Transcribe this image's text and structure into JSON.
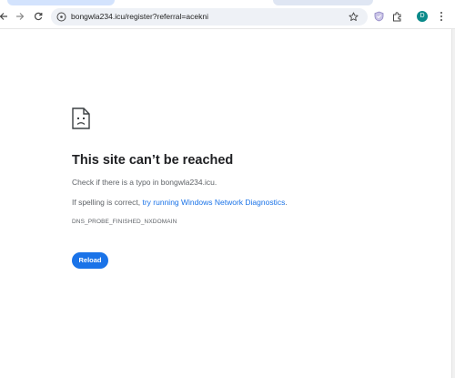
{
  "browser": {
    "url": "bongwla234.icu/register?referral=acekni",
    "profile_initial": "D",
    "colors": {
      "omnibox_bg": "#eef1f6",
      "accent": "#1a73e8",
      "profile": "#0b8a8a"
    }
  },
  "toolbar": {
    "back_icon": "arrow-left-icon",
    "forward_icon": "arrow-right-icon",
    "reload_icon": "reload-icon",
    "site_info_icon": "site-info-icon",
    "bookmark_icon": "star-icon",
    "extensions": [
      "shield-extension-icon",
      "puzzle-extensions-icon"
    ],
    "menu_icon": "three-dots-menu-icon"
  },
  "error_page": {
    "icon": "sad-page-icon",
    "title": "This site can’t be reached",
    "line1": "Check if there is a typo in bongwla234.icu.",
    "line2_prefix": "If spelling is correct, ",
    "line2_link": "try running Windows Network Diagnostics",
    "line2_suffix": ".",
    "error_code": "DNS_PROBE_FINISHED_NXDOMAIN",
    "reload_label": "Reload"
  }
}
